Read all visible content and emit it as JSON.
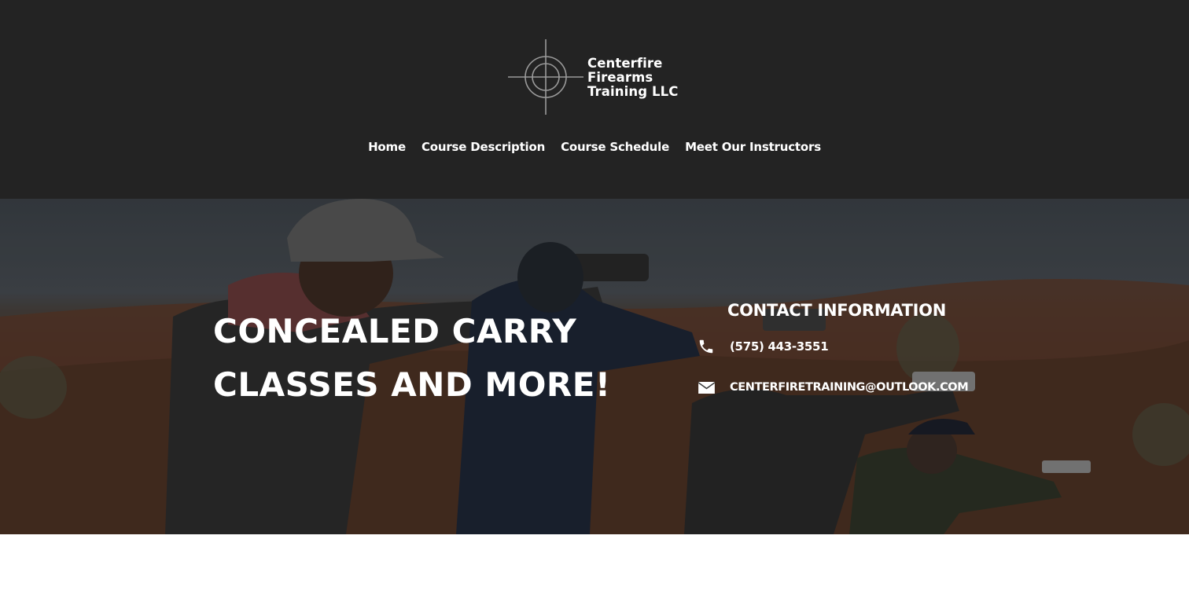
{
  "brand": {
    "name_lines": [
      "Centerfire",
      "Firearms",
      "Training LLC"
    ],
    "logo_icon": "crosshair-icon"
  },
  "nav": {
    "items": [
      {
        "label": "Home"
      },
      {
        "label": "Course Description"
      },
      {
        "label": "Course Schedule"
      },
      {
        "label": "Meet Our Instructors"
      }
    ]
  },
  "hero": {
    "headline_lines": [
      "CONCEALED CARRY",
      "CLASSES AND MORE!"
    ],
    "background_image": "shooters-at-range-photo"
  },
  "contact": {
    "title": "CONTACT INFORMATION",
    "phone": {
      "icon": "phone-icon",
      "value": "(575) 443-3551"
    },
    "email": {
      "icon": "envelope-icon",
      "value": "CENTERFIRETRAINING@OUTLOOK.COM"
    }
  },
  "colors": {
    "header_bg": "#232323",
    "text": "#ffffff"
  }
}
